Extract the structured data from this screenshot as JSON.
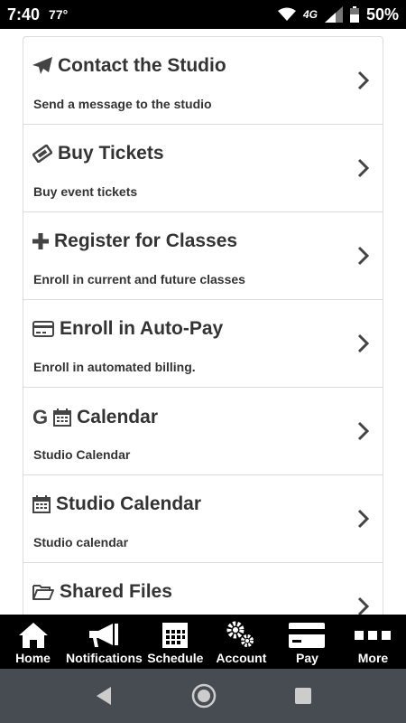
{
  "status": {
    "time": "7:40",
    "temp": "77°",
    "network": "4G",
    "battery": "50%"
  },
  "menu": [
    {
      "title": "Contact the Studio",
      "subtitle": "Send a message to the studio",
      "icon": "paper-plane-icon"
    },
    {
      "title": "Buy Tickets",
      "subtitle": "Buy event tickets",
      "icon": "ticket-icon"
    },
    {
      "title": "Register for Classes",
      "subtitle": "Enroll in current and future classes",
      "icon": "plus-icon"
    },
    {
      "title": "Enroll in Auto-Pay",
      "subtitle": "Enroll in automated billing.",
      "icon": "credit-card-icon"
    },
    {
      "title": "Calendar",
      "subtitle": "Studio Calendar",
      "icon": "calendar-icon",
      "prefix": "G"
    },
    {
      "title": "Studio Calendar",
      "subtitle": "Studio calendar",
      "icon": "calendar-icon"
    },
    {
      "title": "Shared Files",
      "subtitle": "",
      "icon": "folder-open-icon"
    }
  ],
  "nav": [
    {
      "label": "Home",
      "icon": "home-icon"
    },
    {
      "label": "Notifications",
      "icon": "megaphone-icon"
    },
    {
      "label": "Schedule",
      "icon": "calendar-grid-icon"
    },
    {
      "label": "Account",
      "icon": "gears-icon"
    },
    {
      "label": "Pay",
      "icon": "credit-card-icon"
    },
    {
      "label": "More",
      "icon": "more-icon"
    }
  ]
}
